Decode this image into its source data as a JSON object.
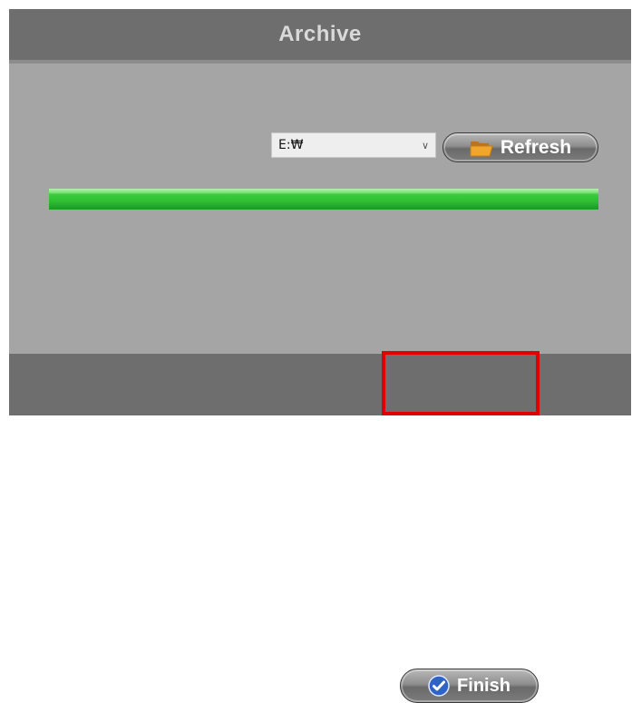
{
  "dialog": {
    "title": "Archive"
  },
  "drive_select": {
    "value": "E:₩",
    "options": [
      "E:₩"
    ]
  },
  "refresh_button": {
    "label": "Refresh",
    "icon": "folder-icon"
  },
  "progress": {
    "fraction": 1.0
  },
  "finish_button": {
    "label": "Finish",
    "icon": "checkmark-icon",
    "highlighted": true
  },
  "colors": {
    "title_bar": "#6e6e6e",
    "panel": "#a5a5a5",
    "progress_green": "#2fbe34",
    "highlight_red": "#e00000"
  }
}
